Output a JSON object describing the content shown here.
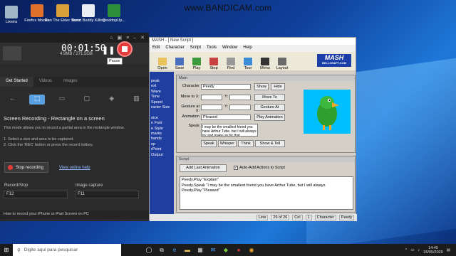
{
  "watermark": "www.BANDICAM.com",
  "desktop_icons": [
    {
      "label": "Lixeira",
      "color": "#9fb7c9"
    },
    {
      "label": "Firefox Mozilla",
      "color": "#e0702a"
    },
    {
      "label": "Ron The Elder Sonic",
      "color": "#d9a03a"
    },
    {
      "label": "Bonzi Buddy Killing",
      "color": "#e9eef5"
    },
    {
      "label": "DesktopUp...",
      "color": "#2e8f3a"
    }
  ],
  "bandicam": {
    "timer": "00:01:50",
    "size": "4.9MB / 271.5GB",
    "pause_tooltip": "Pause",
    "tabs": [
      "Get Started",
      "Videos",
      "Images"
    ],
    "mode_title": "Screen Recording - Rectangle on a screen",
    "mode_desc": "This mode allows you to record a partial area in the rectangle window.",
    "steps": [
      "1. Select a size and area to be captured.",
      "2. Click the 'REC' button or press the record hotkey."
    ],
    "stop_recording": "Stop recording",
    "view_help": "View online help",
    "hotkeys": [
      {
        "label": "Record/Stop",
        "value": "F12"
      },
      {
        "label": "Image capture",
        "value": "F11"
      }
    ],
    "footer": "How to record your iPhone or iPad Screen on PC"
  },
  "mash": {
    "title": "MASH - [ New Script ]",
    "menu": [
      "Edit",
      "Character",
      "Script",
      "Tools",
      "Window",
      "Help"
    ],
    "toolbar": [
      "Open",
      "Save",
      "Play",
      "Stop",
      "Find",
      "Tour",
      "Menu",
      "Layout"
    ],
    "logo": "MASH",
    "logo_sub": "BELLCRAFT.COM",
    "side_links": [
      "peak",
      "ext",
      "Wave",
      "Time",
      "Speed",
      "racter Size",
      "",
      "oice",
      "n Font",
      "e Style",
      "marks",
      "hands",
      "op",
      "rPoint",
      "Output"
    ],
    "main_title": "Main",
    "character_label": "Character",
    "character_value": "Peedy",
    "show": "Show",
    "hide": "Hide",
    "move_label": "Move to X:",
    "move_to": "Move To",
    "gesture_label": "Gesture at X:",
    "gesture_at": "Gesture At",
    "y_label": "Y:",
    "animation_label": "Animation",
    "animation_value": "Pleased",
    "play_animation": "Play Animation",
    "speak_label": "Speak",
    "speak_text": "I may be the smallest friend you have Arthur Tube, but I will always try and make up for that",
    "actions": [
      "Speak",
      "Whisper",
      "Think",
      "Show & Tell"
    ],
    "script_title": "Script",
    "add_last_animation": "Add Last Animation",
    "auto_add": "Auto-Add Actions to Script",
    "script_lines": [
      "Peedy.Play \"Explain\"",
      "Peedy.Speak \"I may be the smallest friend you have Arthur Tube, but I will always",
      "Peedy.Play \"Pleased\""
    ],
    "status": [
      "Line",
      "26 of 26",
      "Col",
      "1",
      "Character",
      "Peedy"
    ]
  },
  "taskbar": {
    "search_placeholder": "Digite aqui para pesquisar",
    "time": "14:45",
    "date": "26/05/2020"
  }
}
